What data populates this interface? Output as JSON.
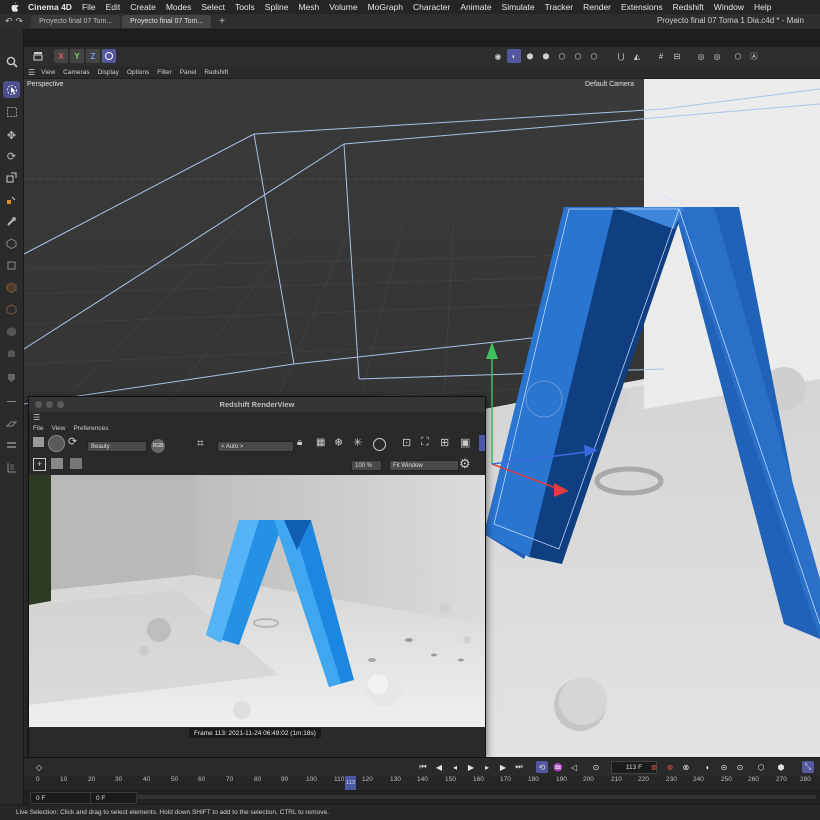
{
  "menubar": {
    "app_name": "Cinema 4D",
    "items": [
      "File",
      "Edit",
      "Create",
      "Modes",
      "Select",
      "Tools",
      "Spline",
      "Mesh",
      "Volume",
      "MoGraph",
      "Character",
      "Animate",
      "Simulate",
      "Tracker",
      "Render",
      "Extensions",
      "Redshift",
      "Window",
      "Help"
    ]
  },
  "tabs": [
    {
      "label": "Proyecto final 07 Tom..."
    },
    {
      "label": "Proyecto final 07 Tom..."
    }
  ],
  "document_title": "Proyecto final 07 Toma 1 Dia.c4d * - Main",
  "viewport_toolbar": {
    "x": "X",
    "y": "Y",
    "z": "Z"
  },
  "viewport_menu": [
    "View",
    "Cameras",
    "Display",
    "Options",
    "Filter",
    "Panel",
    "Redshift"
  ],
  "viewport": {
    "label": "Perspective",
    "camera": "Default Camera"
  },
  "renderview": {
    "title": "Redshift RenderView",
    "menu": [
      "File",
      "View",
      "Preferences"
    ],
    "aov": "Beauty",
    "rgb": "RGB",
    "camera": "< Auto >",
    "zoom": "100 %",
    "fit": "Fit Window",
    "status": "Frame  113:  2021-11-24  06:49:02  (1m:18s)"
  },
  "timeline": {
    "current_frame": "113 F",
    "ticks": [
      "0",
      "10",
      "20",
      "30",
      "40",
      "50",
      "60",
      "70",
      "80",
      "90",
      "100",
      "110",
      "120",
      "130",
      "140",
      "150",
      "160",
      "170",
      "180",
      "190",
      "200",
      "210",
      "220",
      "230",
      "240",
      "250",
      "260",
      "270",
      "280"
    ],
    "playhead_label": "113",
    "start_field": "0 F",
    "end_field": "0 F"
  },
  "status": "Live Selection: Click and drag to select elements. Hold down SHIFT to add to the selection, CTRL to remove."
}
